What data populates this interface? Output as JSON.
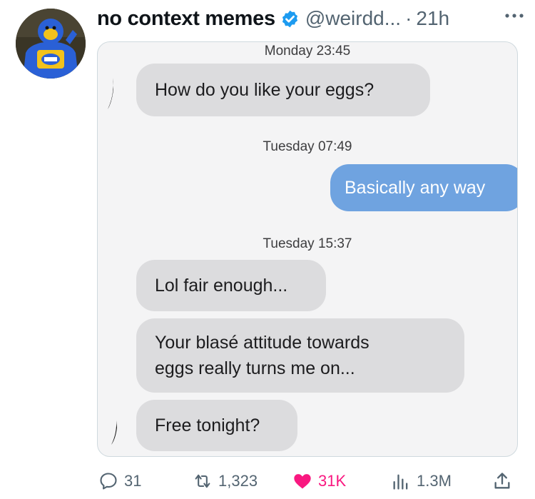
{
  "post": {
    "display_name": "no context memes",
    "handle": "@weirdd...",
    "separator": "·",
    "time": "21h"
  },
  "chat": {
    "messages": [
      {
        "type": "timestamp",
        "text": "Monday 23:45"
      },
      {
        "type": "incoming",
        "text": "How do you like your eggs?"
      },
      {
        "type": "timestamp",
        "text": "Tuesday 07:49"
      },
      {
        "type": "outgoing",
        "text": "Basically any way"
      },
      {
        "type": "timestamp",
        "text": "Tuesday 15:37"
      },
      {
        "type": "incoming",
        "text": "Lol fair enough..."
      },
      {
        "type": "incoming",
        "text_line1": "Your blasé attitude towards",
        "text_line2": "eggs really turns me on..."
      },
      {
        "type": "incoming",
        "text": "Free tonight?"
      }
    ]
  },
  "actions": {
    "replies": "31",
    "reposts": "1,323",
    "likes": "31K",
    "views": "1.3M"
  },
  "colors": {
    "like": "#f91880",
    "verified": "#1d9bf0",
    "muted": "#536471",
    "outgoing_bubble": "#6fa3e0",
    "incoming_bubble": "#dcdcde"
  },
  "icons": [
    "avatar",
    "verified-badge-icon",
    "more-icon",
    "reply-icon",
    "repost-icon",
    "heart-icon",
    "views-icon",
    "share-icon"
  ]
}
